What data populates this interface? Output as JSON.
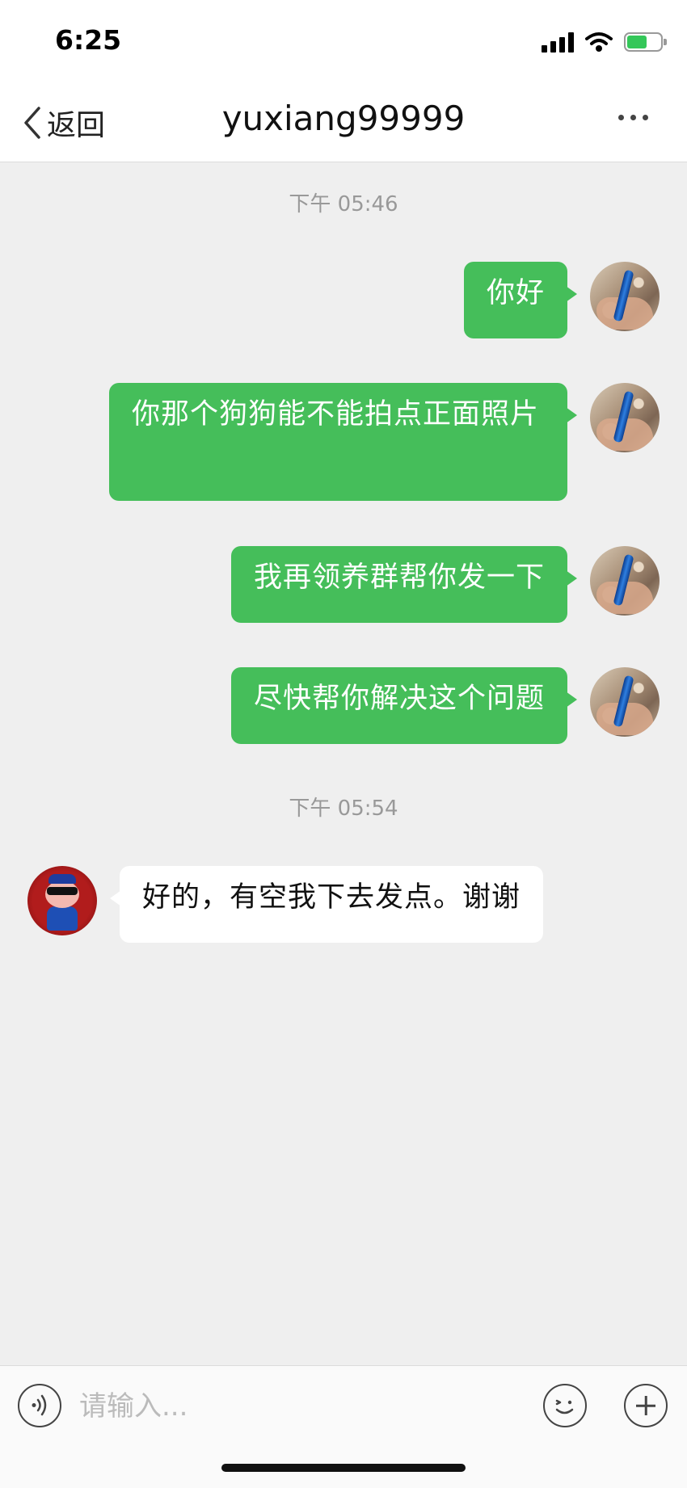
{
  "status_bar": {
    "time": "6:25"
  },
  "nav": {
    "back_label": "返回",
    "title": "yuxiang99999"
  },
  "timestamps": [
    "下午 05:46",
    "下午 05:54"
  ],
  "messages": [
    {
      "from": "me",
      "text": "你好"
    },
    {
      "from": "me",
      "text": "你那个狗狗能不能拍点正面照片"
    },
    {
      "from": "me",
      "text": "我再领养群帮你发一下"
    },
    {
      "from": "me",
      "text": "尽快帮你解决这个问题"
    },
    {
      "from": "other",
      "text": "好的，有空我下去发点。谢谢"
    }
  ],
  "input": {
    "placeholder": "请输入..."
  },
  "colors": {
    "outgoing_bubble": "#45be5a",
    "incoming_bubble": "#ffffff",
    "chat_background": "#efefef"
  },
  "icons": [
    "back-chevron-icon",
    "more-dots-icon",
    "voice-icon",
    "emoji-icon",
    "plus-icon",
    "signal-icon",
    "wifi-icon",
    "battery-icon"
  ]
}
